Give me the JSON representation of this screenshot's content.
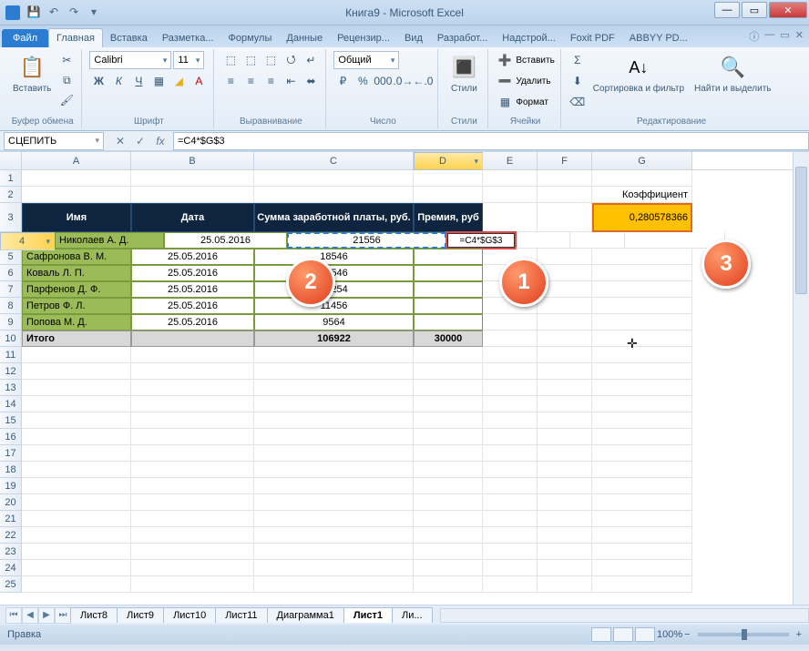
{
  "window": {
    "title": "Книга9 - Microsoft Excel"
  },
  "qat": {
    "save": "💾",
    "undo": "↶",
    "redo": "↷"
  },
  "tabs": {
    "file": "Файл",
    "items": [
      "Главная",
      "Вставка",
      "Разметка...",
      "Формулы",
      "Данные",
      "Рецензир...",
      "Вид",
      "Разработ...",
      "Надстрой...",
      "Foxit PDF",
      "ABBYY PD..."
    ],
    "active": 0
  },
  "ribbon": {
    "clipboard": {
      "label": "Буфер обмена",
      "paste": "Вставить"
    },
    "font": {
      "label": "Шрифт",
      "name": "Calibri",
      "size": "11"
    },
    "align": {
      "label": "Выравнивание"
    },
    "number": {
      "label": "Число",
      "format": "Общий"
    },
    "styles": {
      "label": "Стили",
      "btn": "Стили"
    },
    "cells": {
      "label": "Ячейки",
      "insert": "Вставить",
      "delete": "Удалить",
      "format": "Формат"
    },
    "editing": {
      "label": "Редактирование",
      "sort": "Сортировка и фильтр",
      "find": "Найти и выделить"
    }
  },
  "fx": {
    "namebox": "СЦЕПИТЬ",
    "formula": "=C4*$G$3"
  },
  "columns": [
    "A",
    "B",
    "C",
    "D",
    "E",
    "F",
    "G"
  ],
  "headers": {
    "name": "Имя",
    "date": "Дата",
    "sum": "Сумма заработной платы, руб.",
    "prem": "Премия, руб"
  },
  "coefLabel": "Коэффициент",
  "coefValue": "0,280578366",
  "activeFormula": "=C4*$G$3",
  "rows": [
    {
      "n": "Николаев А. Д.",
      "d": "25.05.2016",
      "s": "21556"
    },
    {
      "n": "Сафронова В. М.",
      "d": "25.05.2016",
      "s": "18546"
    },
    {
      "n": "Коваль Л. П.",
      "d": "25.05.2016",
      "s": "10546"
    },
    {
      "n": "Парфенов Д. Ф.",
      "d": "25.05.2016",
      "s": "35254"
    },
    {
      "n": "Петров Ф. Л.",
      "d": "25.05.2016",
      "s": "11456"
    },
    {
      "n": "Попова М. Д.",
      "d": "25.05.2016",
      "s": "9564"
    }
  ],
  "total": {
    "label": "Итого",
    "sum": "106922",
    "prem": "30000"
  },
  "anno": {
    "a1": "1",
    "a2": "2",
    "a3": "3"
  },
  "sheets": {
    "nav": [
      "⏮",
      "◀",
      "▶",
      "⏭"
    ],
    "tabs": [
      "Лист8",
      "Лист9",
      "Лист10",
      "Лист11",
      "Диаграмма1",
      "Лист1",
      "Ли..."
    ],
    "active": 5
  },
  "status": {
    "mode": "Правка",
    "zoom": "100%"
  }
}
